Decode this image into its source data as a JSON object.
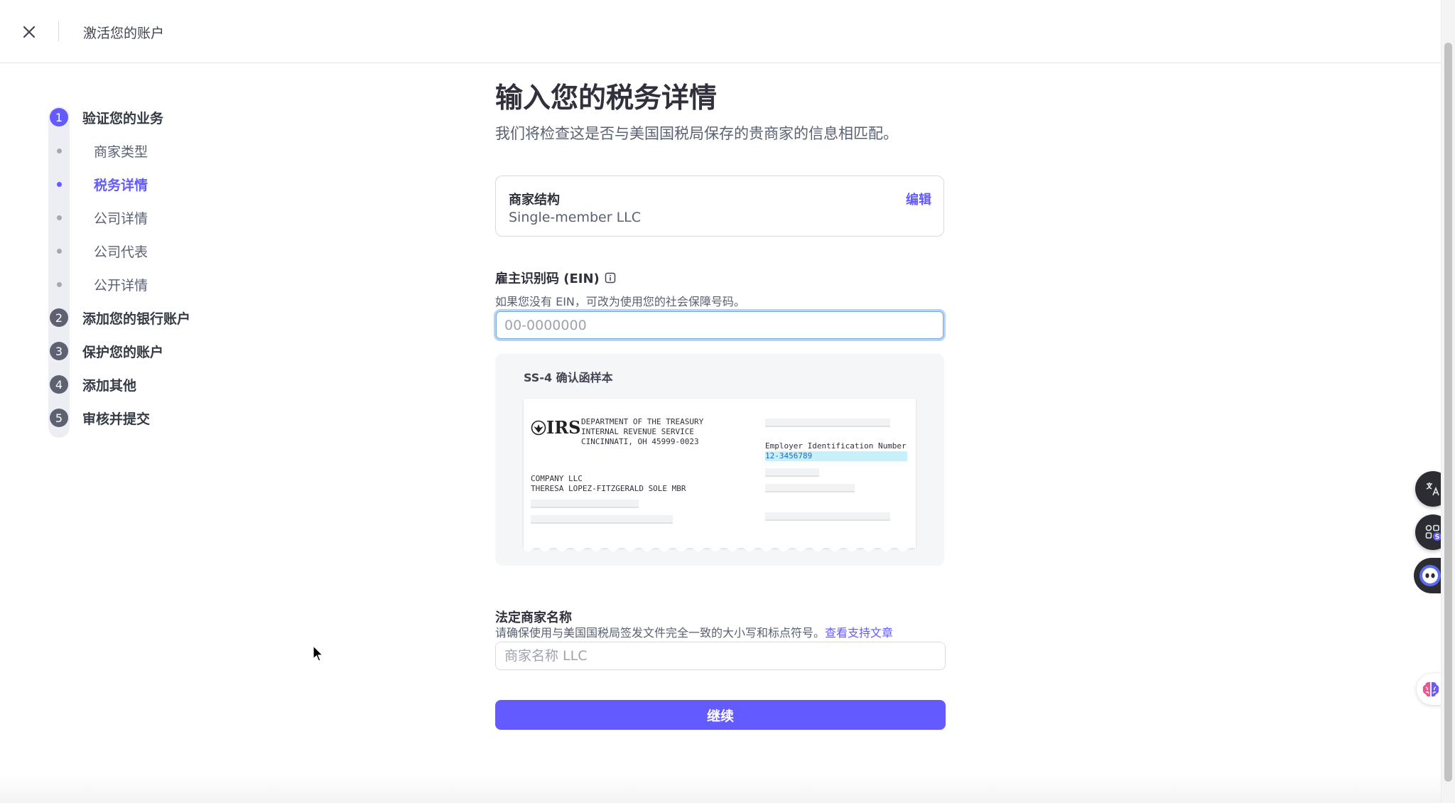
{
  "header": {
    "title": "激活您的账户"
  },
  "stepper": {
    "steps": [
      {
        "number": "1",
        "label": "验证您的业务",
        "active": true
      },
      {
        "number": "2",
        "label": "添加您的银行账户"
      },
      {
        "number": "3",
        "label": "保护您的账户"
      },
      {
        "number": "4",
        "label": "添加其他"
      },
      {
        "number": "5",
        "label": "审核并提交"
      }
    ],
    "substeps": [
      {
        "label": "商家类型"
      },
      {
        "label": "税务详情",
        "active": true
      },
      {
        "label": "公司详情"
      },
      {
        "label": "公司代表"
      },
      {
        "label": "公开详情"
      }
    ]
  },
  "main": {
    "title": "输入您的税务详情",
    "subtitle": "我们将检查这是否与美国国税局保存的贵商家的信息相匹配。",
    "business_structure": {
      "label": "商家结构",
      "value": "Single-member LLC",
      "edit_label": "编辑"
    },
    "ein": {
      "label": "雇主识别码 (EIN)",
      "help": "如果您没有 EIN，可改为使用您的社会保障号码。",
      "placeholder": "00-0000000",
      "value": ""
    },
    "sample": {
      "title": "SS-4 确认函样本",
      "logo_text": "IRS",
      "agency_lines": [
        "DEPARTMENT OF THE TREASURY",
        "INTERNAL REVENUE SERVICE",
        "CINCINNATI, OH 45999-0023"
      ],
      "company_lines": [
        "COMPANY LLC",
        "THERESA LOPEZ-FITZGERALD SOLE MBR"
      ],
      "ein_caption": "Employer Identification Number",
      "ein_value": "12-3456789"
    },
    "legal_name": {
      "label": "法定商家名称",
      "help": "请确保使用与美国国税局签发文件完全一致的大小写和标点符号。",
      "link": "查看支持文章",
      "placeholder": "商家名称 LLC",
      "value": ""
    },
    "continue_label": "继续"
  },
  "colors": {
    "accent": "#635bff",
    "text": "#30313d",
    "muted": "#596171",
    "step_inactive": "#5e6172",
    "focus_ring": "#b6d3f5",
    "ein_highlight": "#c8f0fa"
  },
  "icons": {
    "close": "close-icon",
    "info": "info-icon",
    "translate": "translate-icon",
    "apps": "apps-icon",
    "assistant": "assistant-icon",
    "brain": "brain-icon"
  }
}
